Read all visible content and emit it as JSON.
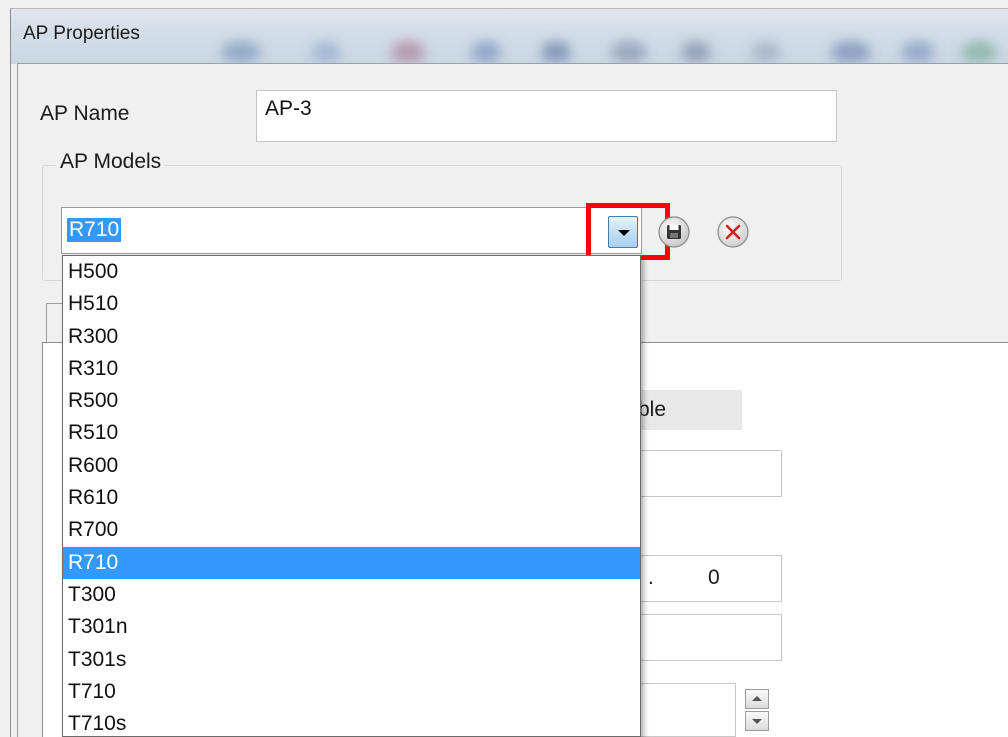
{
  "window": {
    "title": "AP Properties"
  },
  "ap_name": {
    "label": "AP Name",
    "value": "AP-3"
  },
  "ap_models": {
    "group_label": "AP Models",
    "selected_value": "R710",
    "options": [
      "H500",
      "H510",
      "R300",
      "R310",
      "R500",
      "R510",
      "R600",
      "R610",
      "R700",
      "R710",
      "T300",
      "T301n",
      "T301s",
      "T710",
      "T710s"
    ],
    "selected_index": 9
  },
  "icons": {
    "save": "save-icon",
    "delete": "delete-icon",
    "dropdown_arrow": "chevron-down-icon"
  },
  "panel": {
    "partial_label": "ble",
    "numeric_field_partial": ".",
    "numeric_field_value": "0"
  },
  "colors": {
    "selection": "#3399ff",
    "highlight": "#ff0000",
    "delete_icon": "#d42020"
  }
}
